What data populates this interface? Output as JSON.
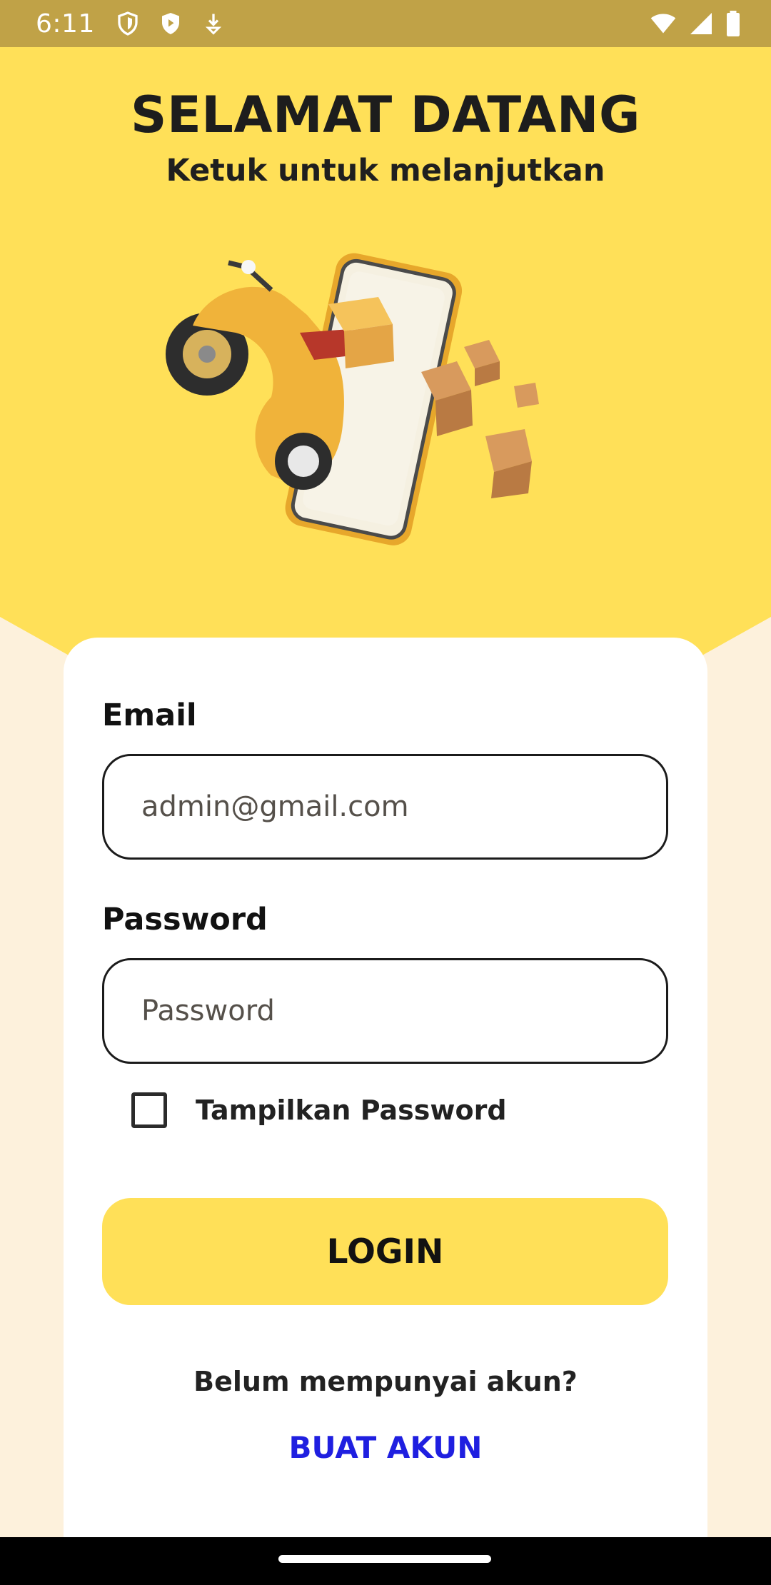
{
  "status_bar": {
    "time": "6:11",
    "left_icons": [
      "shield-outline-icon",
      "shield-play-icon",
      "download-arrow-icon"
    ],
    "right_icons": [
      "wifi-icon",
      "cellular-signal-icon",
      "battery-icon"
    ]
  },
  "header": {
    "title": "SELAMAT DATANG",
    "subtitle": "Ketuk untuk melanjutkan",
    "illustration": "delivery-scooter-phone-boxes-illustration"
  },
  "form": {
    "email_label": "Email",
    "email_value": "admin@gmail.com",
    "password_label": "Password",
    "password_placeholder": "Password",
    "show_password_label": "Tampilkan Password",
    "show_password_checked": false,
    "login_label": "LOGIN",
    "no_account_text": "Belum mempunyai akun?",
    "create_account_label": "BUAT AKUN"
  },
  "colors": {
    "accent_yellow": "#ffe058",
    "status_bar": "#c0a247",
    "background": "#fdf1dc",
    "link_blue": "#1f1fe0"
  }
}
